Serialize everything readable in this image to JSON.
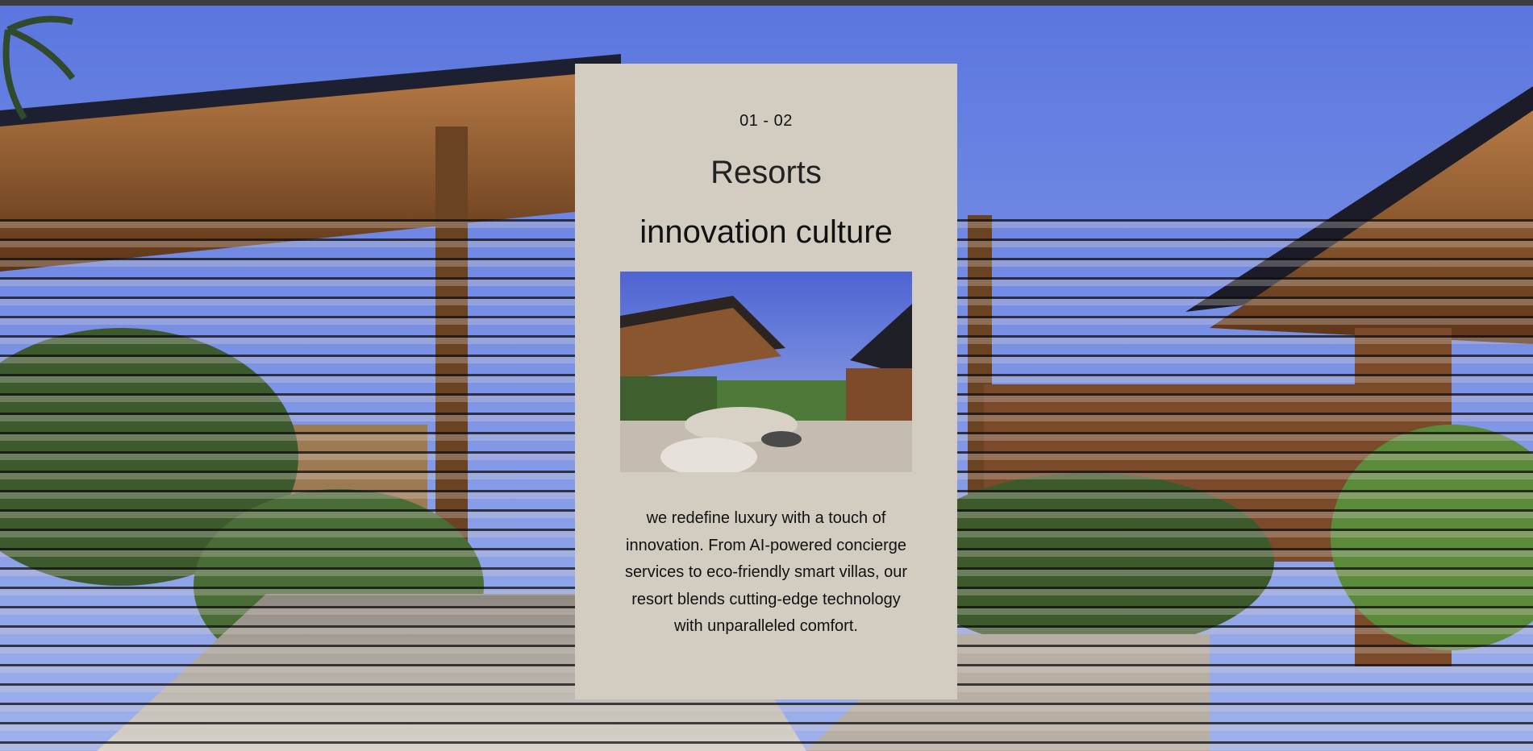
{
  "slide": {
    "counter": "01 - 02",
    "category": "Resorts",
    "headline": "innovation culture",
    "description": "we redefine luxury with a touch of innovation. From AI-powered concierge services to eco-friendly smart villas, our resort blends cutting-edge technology with unparalleled comfort."
  },
  "colors": {
    "card_background": "#d2cdc0",
    "sky": "#6f87e6",
    "wood": "#8a5a34",
    "text": "#111111"
  },
  "images": {
    "background": "resort-exterior-image",
    "thumbnail": "resort-lounge-interior-image"
  }
}
